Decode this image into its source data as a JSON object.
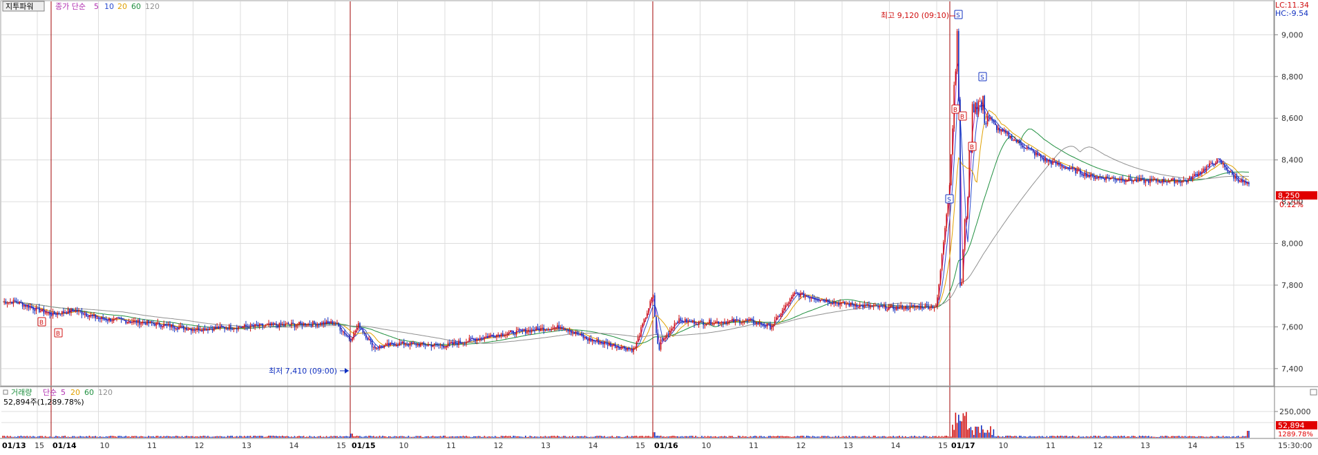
{
  "header": {
    "indicator_name": "지투파워",
    "ma_label": "종가 단순",
    "ma_periods": [
      "5",
      "10",
      "20",
      "60",
      "120"
    ],
    "ma_colors": [
      "#b02fb0",
      "#2a4bd0",
      "#e0a000",
      "#1f8f3f",
      "#909090"
    ],
    "lc": "LC:11.34",
    "hc": "HC:-9.54"
  },
  "volume_header": {
    "label": "거래량",
    "ma_label": "단순",
    "ma_periods": [
      "5",
      "20",
      "60",
      "120"
    ],
    "ma_colors": [
      "#b02fb0",
      "#e0a000",
      "#1f8f3f",
      "#909090"
    ],
    "current_text": "52,894주(1,289.78%)"
  },
  "annotations": {
    "high_text": "최고 9,120 (09:10)",
    "low_text": "최저 7,410 (09:00)",
    "signal_s": "S",
    "signal_b": "B"
  },
  "price_axis": {
    "ticks": [
      "9,000",
      "8,800",
      "8,600",
      "8,400",
      "8,200",
      "8,000",
      "7,800",
      "7,600",
      "7,400"
    ],
    "current_price": "8,250",
    "current_change": "0.12%"
  },
  "volume_axis": {
    "ticks": [
      "250,000"
    ],
    "current_volume": "52,894",
    "current_pct": "1289.78%"
  },
  "time_axis": {
    "labels": [
      "01/13",
      "15",
      "01/14",
      "10",
      "11",
      "12",
      "13",
      "14",
      "15",
      "01/15",
      "10",
      "11",
      "12",
      "13",
      "14",
      "15",
      "01/16",
      "10",
      "11",
      "12",
      "13",
      "14",
      "15",
      "01/17",
      "10",
      "11",
      "12",
      "13",
      "14",
      "15"
    ],
    "end_time": "15:30:00"
  },
  "colors": {
    "up": "#d01010",
    "down": "#1030c0",
    "grid": "#dcdcdc",
    "day_divider": "#a00000",
    "price_tag_bg": "#e00000"
  },
  "chart_data": {
    "type": "line",
    "title": "",
    "subtitle": "",
    "xlabel": "",
    "ylabel": "",
    "ylim": [
      7330,
      9150
    ],
    "grid": true,
    "days": [
      "01/13",
      "01/14",
      "01/15",
      "01/16",
      "01/17"
    ],
    "series": [
      {
        "name": "close",
        "x": [
          "01/13 15:00",
          "01/14 09:00",
          "01/14 09:30",
          "01/14 10:00",
          "01/14 11:00",
          "01/14 12:00",
          "01/14 13:00",
          "01/14 14:00",
          "01/14 15:00",
          "01/14 15:30",
          "01/15 09:00",
          "01/15 09:30",
          "01/15 10:00",
          "01/15 11:00",
          "01/15 12:00",
          "01/15 13:00",
          "01/15 13:30",
          "01/15 14:00",
          "01/15 15:00",
          "01/15 15:30",
          "01/16 09:00",
          "01/16 09:30",
          "01/16 10:00",
          "01/16 11:00",
          "01/16 11:30",
          "01/16 12:00",
          "01/16 13:00",
          "01/16 14:00",
          "01/16 15:00",
          "01/16 15:30",
          "01/17 09:00",
          "01/17 09:10",
          "01/17 09:30",
          "01/17 10:00",
          "01/17 11:00",
          "01/17 12:00",
          "01/17 13:00",
          "01/17 14:00",
          "01/17 14:40",
          "01/17 15:00",
          "01/17 15:30"
        ],
        "values": [
          7720,
          7660,
          7680,
          7640,
          7620,
          7590,
          7600,
          7610,
          7620,
          7610,
          7540,
          7500,
          7520,
          7510,
          7560,
          7590,
          7600,
          7540,
          7490,
          7500,
          7750,
          7630,
          7620,
          7630,
          7600,
          7760,
          7710,
          7690,
          7700,
          7730,
          8300,
          9120,
          8700,
          8550,
          8400,
          8320,
          8300,
          8300,
          8400,
          8320,
          8250
        ]
      }
    ],
    "volume": {
      "ticks": [
        250000
      ],
      "current": 52894,
      "current_pct": 1289.78
    }
  }
}
